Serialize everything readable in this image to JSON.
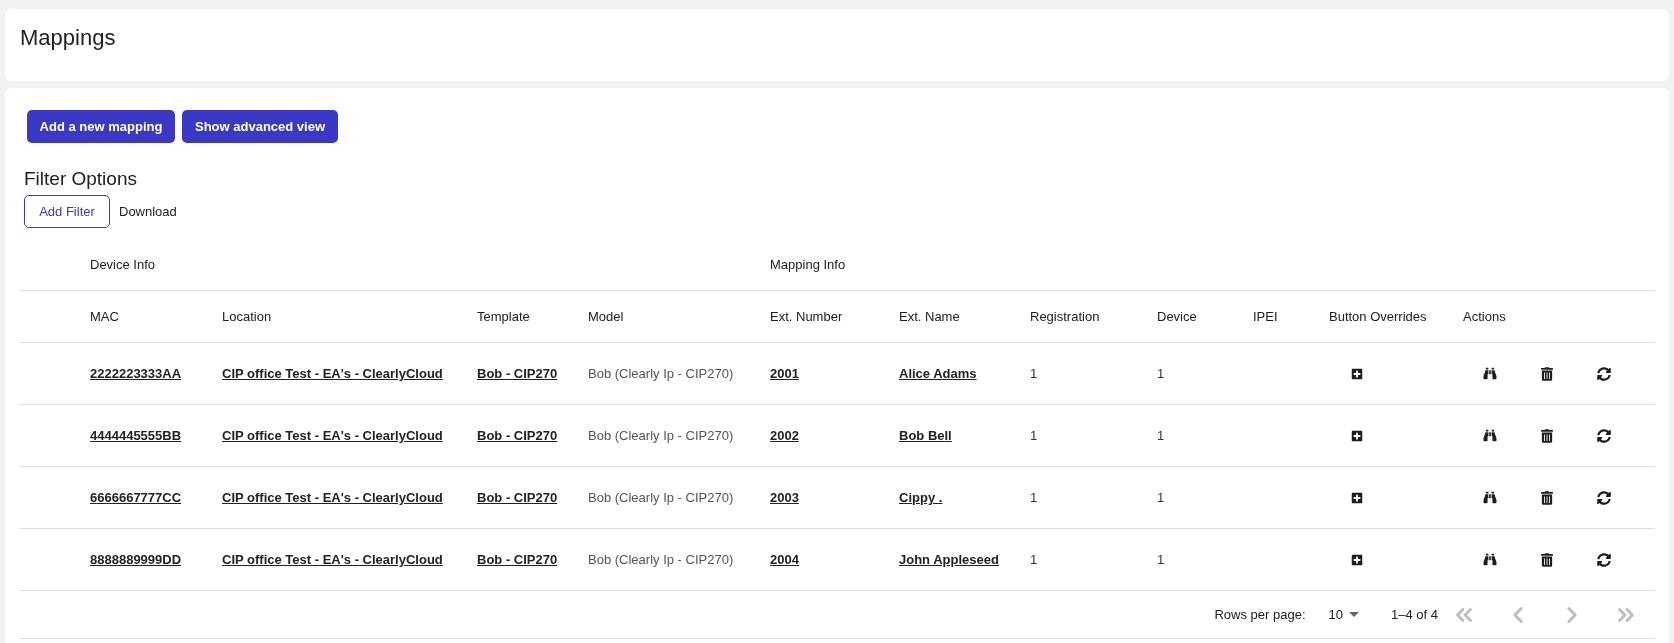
{
  "header": {
    "title": "Mappings"
  },
  "toolbar": {
    "buttons": [
      "Add a new mapping",
      "Show advanced view"
    ]
  },
  "filter": {
    "title": "Filter Options",
    "add_filter": "Add Filter",
    "download": "Download"
  },
  "table": {
    "groups": [
      "Device Info",
      "Mapping Info"
    ],
    "columns": [
      "MAC",
      "Location",
      "Template",
      "Model",
      "Ext. Number",
      "Ext. Name",
      "Registration",
      "Device",
      "IPEI",
      "Button Overrides",
      "Actions"
    ],
    "rows": [
      {
        "mac": "2222223333AA",
        "location": "CIP office Test - EA's - ClearlyCloud",
        "template": "Bob - CIP270",
        "model": "Bob (Clearly Ip - CIP270)",
        "ext_number": "2001",
        "ext_name": "Alice Adams",
        "registration": "1",
        "device": "1"
      },
      {
        "mac": "4444445555BB",
        "location": "CIP office Test - EA's - ClearlyCloud",
        "template": "Bob - CIP270",
        "model": "Bob (Clearly Ip - CIP270)",
        "ext_number": "2002",
        "ext_name": "Bob Bell",
        "registration": "1",
        "device": "1"
      },
      {
        "mac": "6666667777CC",
        "location": "CIP office Test - EA's - ClearlyCloud",
        "template": "Bob - CIP270",
        "model": "Bob (Clearly Ip - CIP270)",
        "ext_number": "2003",
        "ext_name": "Cippy .",
        "registration": "1",
        "device": "1"
      },
      {
        "mac": "8888889999DD",
        "location": "CIP office Test - EA's - ClearlyCloud",
        "template": "Bob - CIP270",
        "model": "Bob (Clearly Ip - CIP270)",
        "ext_number": "2004",
        "ext_name": "John Appleseed",
        "registration": "1",
        "device": "1"
      }
    ]
  },
  "pagination": {
    "rows_per_page_label": "Rows per page:",
    "rows_per_page": "10",
    "range": "1–4 of 4",
    "nav": [
      {
        "kind": "first",
        "disabled": true
      },
      {
        "kind": "previous",
        "disabled": true
      },
      {
        "kind": "next",
        "disabled": true
      },
      {
        "kind": "last",
        "disabled": true
      }
    ]
  }
}
